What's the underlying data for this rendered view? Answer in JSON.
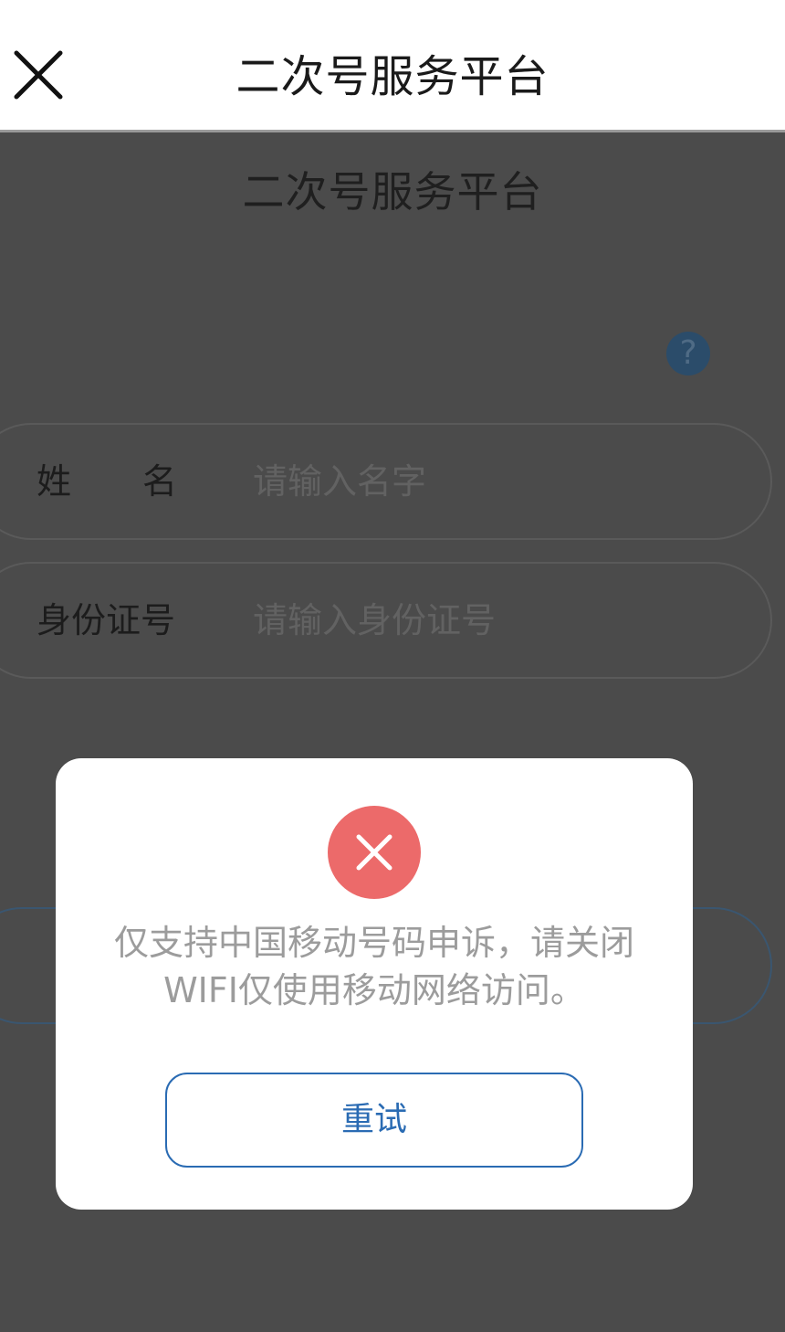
{
  "topbar": {
    "close_icon": "close-icon",
    "title": "二次号服务平台"
  },
  "page": {
    "title": "二次号服务平台",
    "help_icon": "question-icon",
    "help_symbol": "?",
    "fields": {
      "name": {
        "label": "姓名",
        "placeholder": "请输入名字",
        "value": ""
      },
      "id_number": {
        "label": "身份证号",
        "placeholder": "请输入身份证号",
        "value": ""
      }
    }
  },
  "modal": {
    "icon": "error-x-icon",
    "message": "仅支持中国移动号码申诉，请关闭WIFI仅使用移动网络访问。",
    "retry_label": "重试"
  },
  "colors": {
    "overlay": "#4b4b4b",
    "error": "#ec6a6a",
    "accent": "#2a6bb3"
  }
}
